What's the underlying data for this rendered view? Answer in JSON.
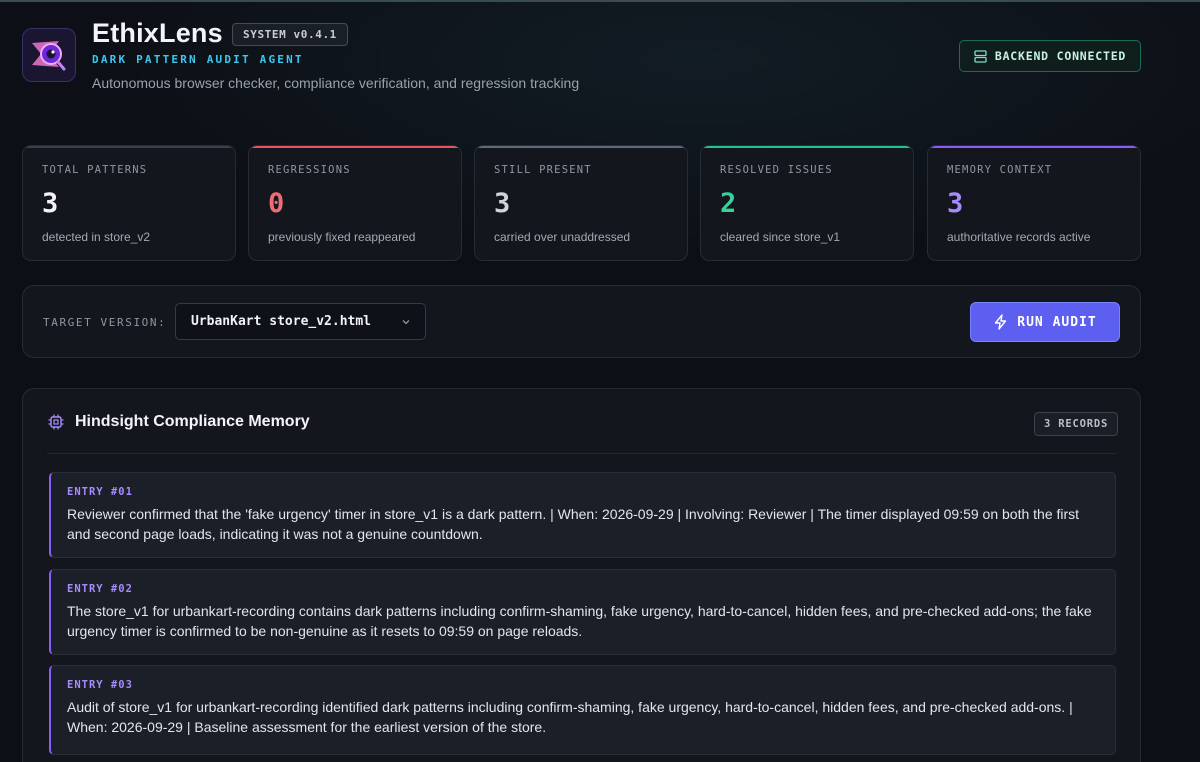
{
  "app": {
    "name": "EthixLens",
    "version": "SYSTEM v0.4.1",
    "subtitle": "DARK PATTERN AUDIT AGENT",
    "tagline": "Autonomous browser checker, compliance verification, and regression tracking",
    "backend_status": "BACKEND CONNECTED"
  },
  "colors": {
    "accent_purple": "#8b5cf6",
    "accent_cyan": "#3bc8f0",
    "regression_red": "#f06a78",
    "resolved_green": "#34d399",
    "neutral": "#cfd3da",
    "run_button": "#5c5ff0"
  },
  "stats": [
    {
      "label": "TOTAL PATTERNS",
      "value": "3",
      "desc": "detected in store_v2"
    },
    {
      "label": "REGRESSIONS",
      "value": "0",
      "desc": "previously fixed reappeared"
    },
    {
      "label": "STILL PRESENT",
      "value": "3",
      "desc": "carried over unaddressed"
    },
    {
      "label": "RESOLVED ISSUES",
      "value": "2",
      "desc": "cleared since store_v1"
    },
    {
      "label": "MEMORY CONTEXT",
      "value": "3",
      "desc": "authoritative records active"
    }
  ],
  "target": {
    "label": "TARGET VERSION:",
    "selected": "UrbanKart store_v2.html",
    "run_label": "RUN AUDIT"
  },
  "memory": {
    "title": "Hindsight Compliance Memory",
    "records_badge": "3 RECORDS",
    "entries": [
      {
        "tag": "ENTRY #01",
        "text": "Reviewer confirmed that the 'fake urgency' timer in store_v1 is a dark pattern. | When: 2026-09-29 | Involving: Reviewer | The timer displayed 09:59 on both the first and second page loads, indicating it was not a genuine countdown."
      },
      {
        "tag": "ENTRY #02",
        "text": "The store_v1 for urbankart-recording contains dark patterns including confirm-shaming, fake urgency, hard-to-cancel, hidden fees, and pre-checked add-ons; the fake urgency timer is confirmed to be non-genuine as it resets to 09:59 on page reloads."
      },
      {
        "tag": "ENTRY #03",
        "text": "Audit of store_v1 for urbankart-recording identified dark patterns including confirm-shaming, fake urgency, hard-to-cancel, hidden fees, and pre-checked add-ons. | When: 2026-09-29 | Baseline assessment for the earliest version of the store."
      }
    ]
  }
}
